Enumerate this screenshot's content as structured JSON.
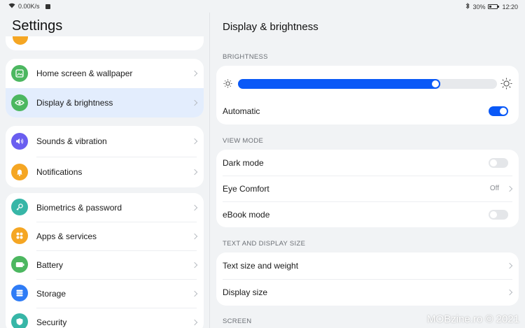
{
  "status_bar": {
    "network_speed": "0.00K/s",
    "battery_percent": "30%",
    "battery_level": 0.3,
    "time": "12:20"
  },
  "settings": {
    "title": "Settings",
    "items": [
      {
        "label": "Home screen & wallpaper",
        "icon": "image-icon",
        "color": "#4cb760"
      },
      {
        "label": "Display & brightness",
        "icon": "eye-icon",
        "color": "#4cb760",
        "selected": true
      },
      {
        "label": "Sounds & vibration",
        "icon": "speaker-icon",
        "color": "#6a5ef0"
      },
      {
        "label": "Notifications",
        "icon": "bell-icon",
        "color": "#f5a623"
      },
      {
        "label": "Biometrics & password",
        "icon": "key-icon",
        "color": "#37b6a7"
      },
      {
        "label": "Apps & services",
        "icon": "grid-icon",
        "color": "#f5a623"
      },
      {
        "label": "Battery",
        "icon": "battery-icon",
        "color": "#4cb760"
      },
      {
        "label": "Storage",
        "icon": "storage-icon",
        "color": "#2f7cf6"
      },
      {
        "label": "Security",
        "icon": "shield-icon",
        "color": "#37b6a7"
      }
    ]
  },
  "detail": {
    "title": "Display & brightness",
    "brightness": {
      "section": "BRIGHTNESS",
      "level": 0.78,
      "automatic_label": "Automatic",
      "automatic_on": true
    },
    "view_mode": {
      "section": "VIEW MODE",
      "dark_mode_label": "Dark mode",
      "dark_mode_on": false,
      "eye_comfort_label": "Eye Comfort",
      "eye_comfort_value": "Off",
      "ebook_label": "eBook mode",
      "ebook_on": false
    },
    "text_display": {
      "section": "TEXT AND DISPLAY SIZE",
      "text_size_label": "Text size and weight",
      "display_size_label": "Display size"
    },
    "screen_section": "SCREEN"
  },
  "watermark": "MOBzine.ro © 2021",
  "colors": {
    "accent": "#0a59f7",
    "selected_bg": "#e3edfd"
  }
}
